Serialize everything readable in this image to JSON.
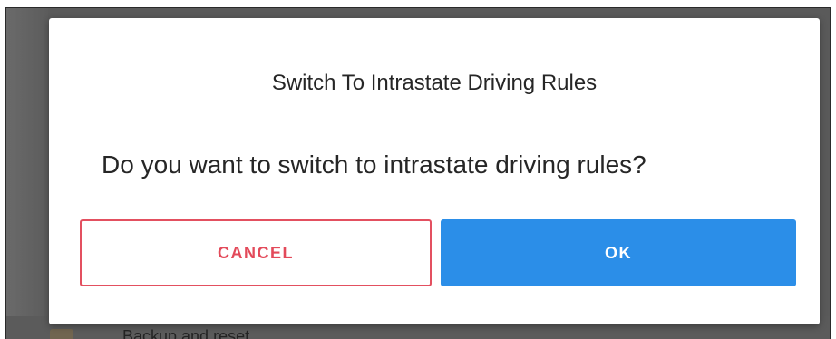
{
  "dialog": {
    "title": "Switch To Intrastate Driving Rules",
    "message": "Do you want to switch to intrastate driving rules?",
    "cancel_label": "CANCEL",
    "ok_label": "OK"
  },
  "background": {
    "item_label": "Backup and reset",
    "item_icon": "backup-icon"
  },
  "colors": {
    "cancel_accent": "#e34a5a",
    "ok_background": "#2b8ee8",
    "overlay": "#5a5a5a"
  }
}
